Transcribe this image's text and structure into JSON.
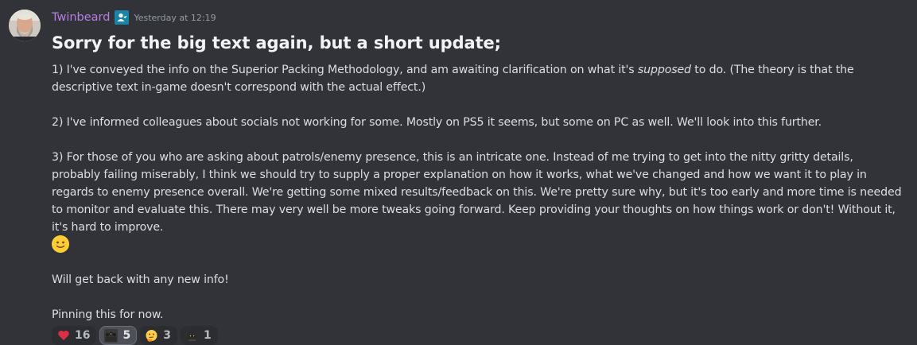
{
  "message": {
    "author": "Twinbeard",
    "timestamp": "Yesterday at 12:19",
    "title": "Sorry for the big text again, but a short update;",
    "p1_before": "1) I've conveyed the info on the Superior Packing Methodology, and am awaiting clarification on what it's ",
    "p1_em": "supposed",
    "p1_after": " to do. (The theory is that the descriptive text in-game doesn't correspond with the actual effect.)",
    "p2": "2) I've informed colleagues about socials not working for some. Mostly on PS5 it seems, but some on PC as well. We'll look into this further.",
    "p3": "3) For those of you who are asking about patrols/enemy presence, this is an intricate one. Instead of me trying to get into the nitty gritty details, probably failing miserably, I think we should try to supply a proper explanation on how it works, what we've changed and how we want it to play in regards to enemy presence overall. We're getting some mixed results/feedback on this. We're pretty sure why, but it's too early and more time is needed to monitor and evaluate this. There may very well be more tweaks going forward. Keep providing your thoughts on how things work or don't! Without it, it's hard to improve.",
    "p3_emoji": "slightly-smiling-face-icon",
    "p4": "Will get back with any new info!",
    "p5": "Pinning this for now."
  },
  "reactions": [
    {
      "icon": "heart-icon",
      "count": "16",
      "active": false
    },
    {
      "icon": "team-emoji-icon",
      "count": "5",
      "active": true
    },
    {
      "icon": "thinking-face-icon",
      "count": "3",
      "active": false
    },
    {
      "icon": "helmet-emoji-icon",
      "count": "1",
      "active": false
    }
  ],
  "colors": {
    "background": "#313338",
    "username": "#b87ee6",
    "text": "#dbdee1",
    "timestamp": "#949ba4",
    "role_icon": "#1a84a8"
  }
}
